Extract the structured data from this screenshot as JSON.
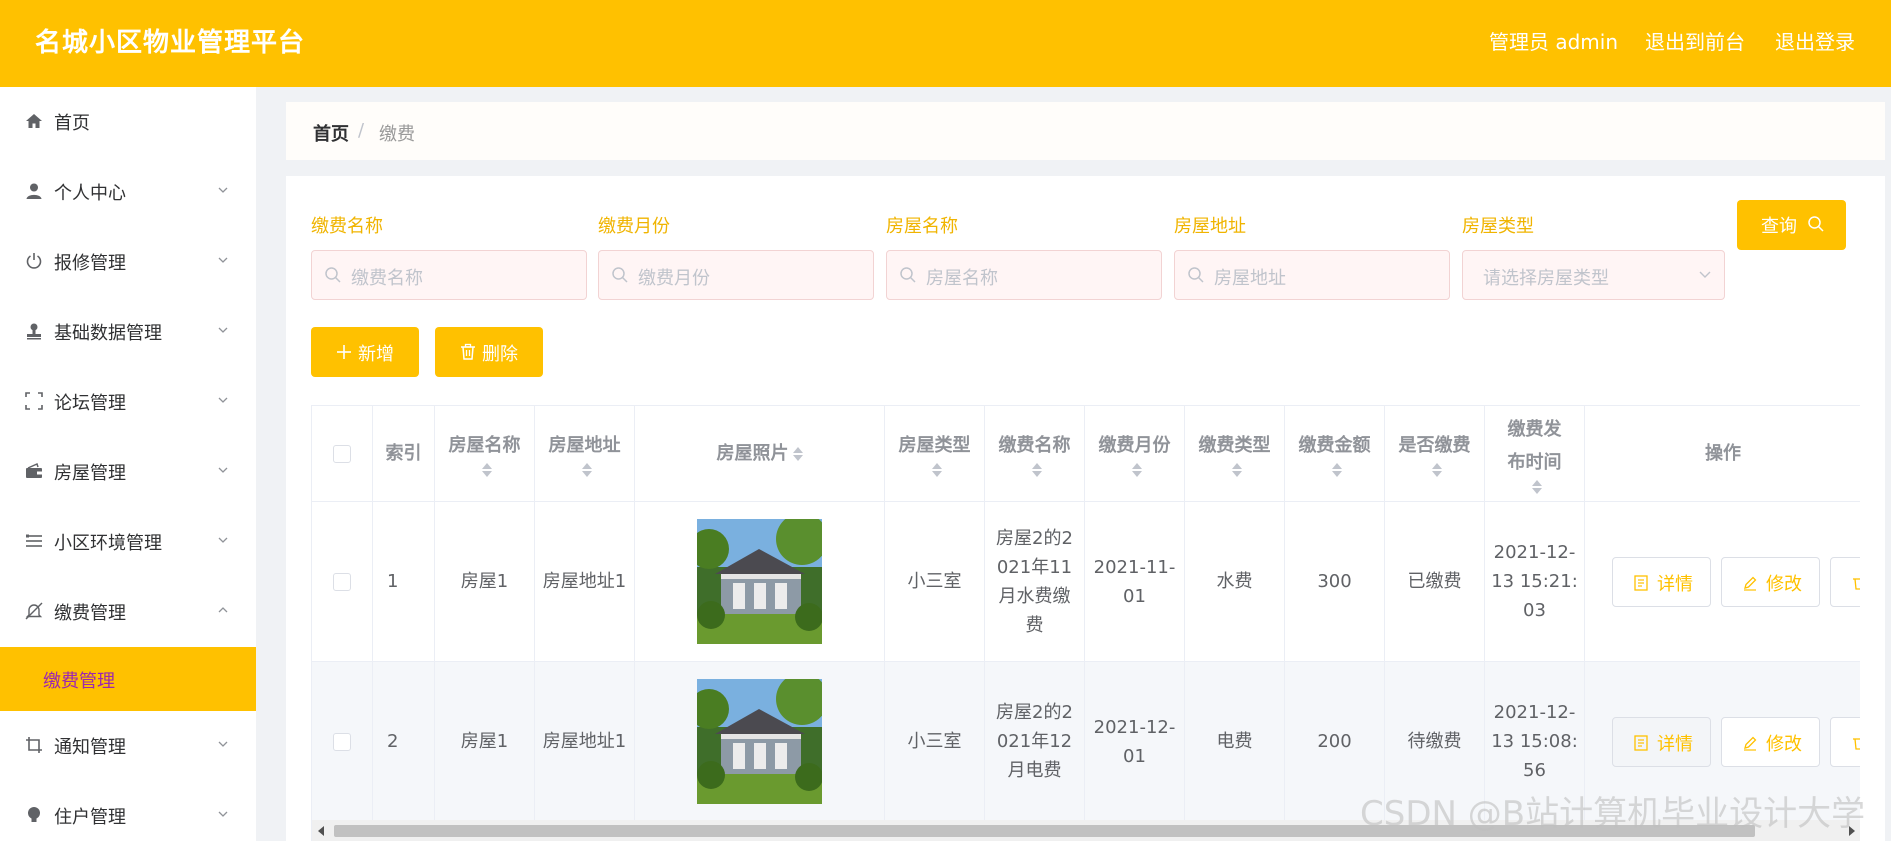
{
  "header": {
    "title": "名城小区物业管理平台",
    "user": "管理员 admin",
    "to_front": "退出到前台",
    "logout": "退出登录"
  },
  "sidebar": {
    "items": [
      {
        "label": "首页",
        "icon": "home-icon"
      },
      {
        "label": "个人中心",
        "icon": "user-icon"
      },
      {
        "label": "报修管理",
        "icon": "power-icon"
      },
      {
        "label": "基础数据管理",
        "icon": "stamp-icon"
      },
      {
        "label": "论坛管理",
        "icon": "crop-frame-icon"
      },
      {
        "label": "房屋管理",
        "icon": "wallet-icon"
      },
      {
        "label": "小区环境管理",
        "icon": "list-icon"
      },
      {
        "label": "缴费管理",
        "icon": "bell-off-icon"
      },
      {
        "label": "通知管理",
        "icon": "crop-icon"
      },
      {
        "label": "住户管理",
        "icon": "bulb-icon"
      }
    ],
    "active_sub": "缴费管理"
  },
  "breadcrumb": {
    "home": "首页",
    "current": "缴费"
  },
  "search": {
    "fields": [
      {
        "label": "缴费名称",
        "placeholder": "缴费名称"
      },
      {
        "label": "缴费月份",
        "placeholder": "缴费月份"
      },
      {
        "label": "房屋名称",
        "placeholder": "房屋名称"
      },
      {
        "label": "房屋地址",
        "placeholder": "房屋地址"
      },
      {
        "label": "房屋类型",
        "placeholder": "请选择房屋类型"
      }
    ],
    "query": "查询"
  },
  "actions": {
    "add": "新增",
    "delete": "删除"
  },
  "table": {
    "columns": [
      "索引",
      "房屋名称",
      "房屋地址",
      "房屋照片",
      "房屋类型",
      "缴费名称",
      "缴费月份",
      "缴费类型",
      "缴费金额",
      "是否缴费",
      "缴费发布时间",
      "操作"
    ],
    "rows": [
      {
        "index": "1",
        "house_name": "房屋1",
        "house_addr": "房屋地址1",
        "house_type": "小三室",
        "fee_name": "房屋2的2021年11月水费缴费",
        "month": "2021-11-01",
        "fee_type": "水费",
        "amount": "300",
        "paid": "已缴费",
        "time": "2021-12-13 15:21:03"
      },
      {
        "index": "2",
        "house_name": "房屋1",
        "house_addr": "房屋地址1",
        "house_type": "小三室",
        "fee_name": "房屋2的2021年12月电费",
        "month": "2021-12-01",
        "fee_type": "电费",
        "amount": "200",
        "paid": "待缴费",
        "time": "2021-12-13 15:08:56"
      }
    ],
    "op_detail": "详情",
    "op_edit": "修改"
  },
  "watermark": "CSDN @B站计算机毕业设计大学",
  "colors": {
    "accent": "#ffc100",
    "label": "#f0b400",
    "active_text": "#9c27b0"
  }
}
